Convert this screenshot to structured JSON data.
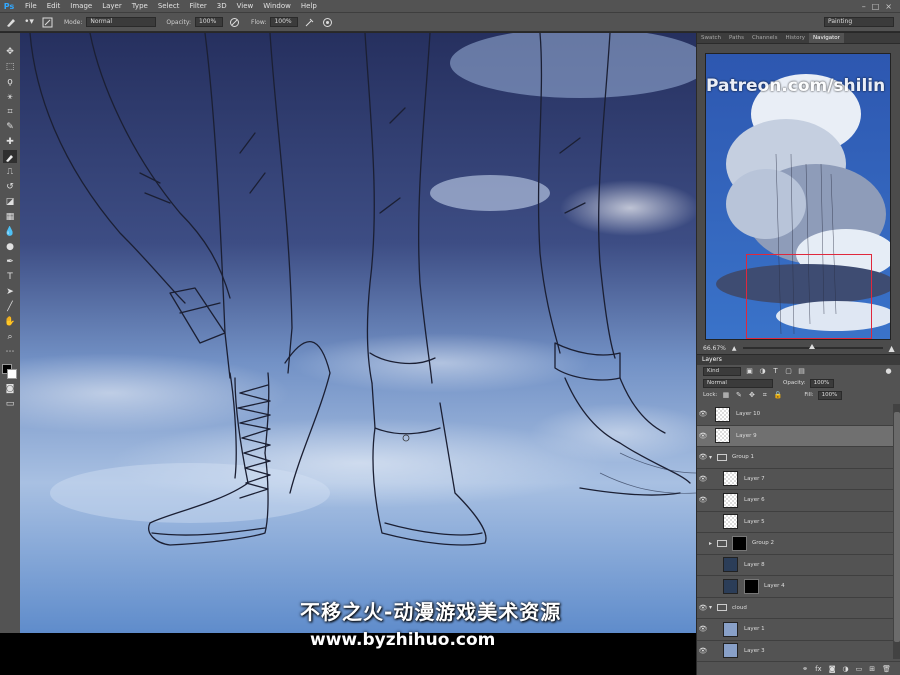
{
  "menu": {
    "logo": "Ps",
    "items": [
      "File",
      "Edit",
      "Image",
      "Layer",
      "Type",
      "Select",
      "Filter",
      "3D",
      "View",
      "Window",
      "Help"
    ]
  },
  "options": {
    "mode_label": "Mode:",
    "mode_value": "Normal",
    "opacity_label": "Opacity:",
    "opacity_value": "100%",
    "flow_label": "Flow:",
    "flow_value": "100%",
    "workspace": "Painting"
  },
  "panels": {
    "top_tabs": [
      "Swatch",
      "Paths",
      "Channels",
      "History",
      "Navigator"
    ],
    "active_top_tab": "Navigator",
    "patreon_text": "Patreon.com/shilin",
    "zoom": "66.67%"
  },
  "layers": {
    "title": "Layers",
    "filter_kind": "Kind",
    "blend_mode": "Normal",
    "opacity_label": "Opacity:",
    "opacity_value": "100%",
    "lock_label": "Lock:",
    "fill_label": "Fill:",
    "fill_value": "100%",
    "items": [
      {
        "name": "Layer 10"
      },
      {
        "name": "Layer 9"
      },
      {
        "name": "Group 1"
      },
      {
        "name": "Layer 7"
      },
      {
        "name": "Layer 6"
      },
      {
        "name": "Layer 5"
      },
      {
        "name": "Group 2"
      },
      {
        "name": "Layer 8"
      },
      {
        "name": "Layer 4"
      },
      {
        "name": "cloud"
      },
      {
        "name": "Layer 1"
      },
      {
        "name": "Layer 3"
      }
    ]
  },
  "overlay": {
    "chinese": "不移之火-动漫游戏美术资源",
    "url": "www.byzhihuo.com"
  },
  "colors": {
    "foreground": "#000000",
    "background": "#ffffff",
    "nav_highlight": "#e0283c"
  }
}
